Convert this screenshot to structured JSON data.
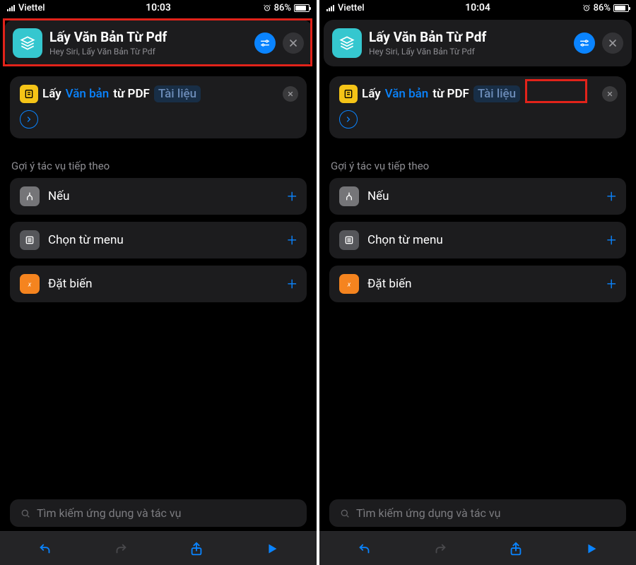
{
  "screens": [
    {
      "status": {
        "carrier": "Viettel",
        "time": "10:03",
        "battery": "86%"
      },
      "header": {
        "title": "Lấy Văn Bản Từ Pdf",
        "subtitle": "Hey Siri, Lấy Văn Bản Từ Pdf"
      },
      "action": {
        "word_lay": "Lấy",
        "token_vanban": "Văn bản",
        "word_tu": "từ PDF",
        "token_tailieu": "Tài liệu"
      },
      "suggest_header": "Gợi ý tác vụ tiếp theo",
      "suggestions": [
        {
          "label": "Nếu",
          "icon": "branch"
        },
        {
          "label": "Chọn từ menu",
          "icon": "menu"
        },
        {
          "label": "Đặt biến",
          "icon": "variable"
        }
      ],
      "search_placeholder": "Tìm kiếm ứng dụng và tác vụ",
      "highlight": "header"
    },
    {
      "status": {
        "carrier": "Viettel",
        "time": "10:04",
        "battery": "86%"
      },
      "header": {
        "title": "Lấy Văn Bản Từ Pdf",
        "subtitle": "Hey Siri, Lấy Văn Bản Từ Pdf"
      },
      "action": {
        "word_lay": "Lấy",
        "token_vanban": "Văn bản",
        "word_tu": "từ PDF",
        "token_tailieu": "Tài liệu"
      },
      "suggest_header": "Gợi ý tác vụ tiếp theo",
      "suggestions": [
        {
          "label": "Nếu",
          "icon": "branch"
        },
        {
          "label": "Chọn từ menu",
          "icon": "menu"
        },
        {
          "label": "Đặt biến",
          "icon": "variable"
        }
      ],
      "search_placeholder": "Tìm kiếm ứng dụng và tác vụ",
      "highlight": "tailieu"
    }
  ]
}
